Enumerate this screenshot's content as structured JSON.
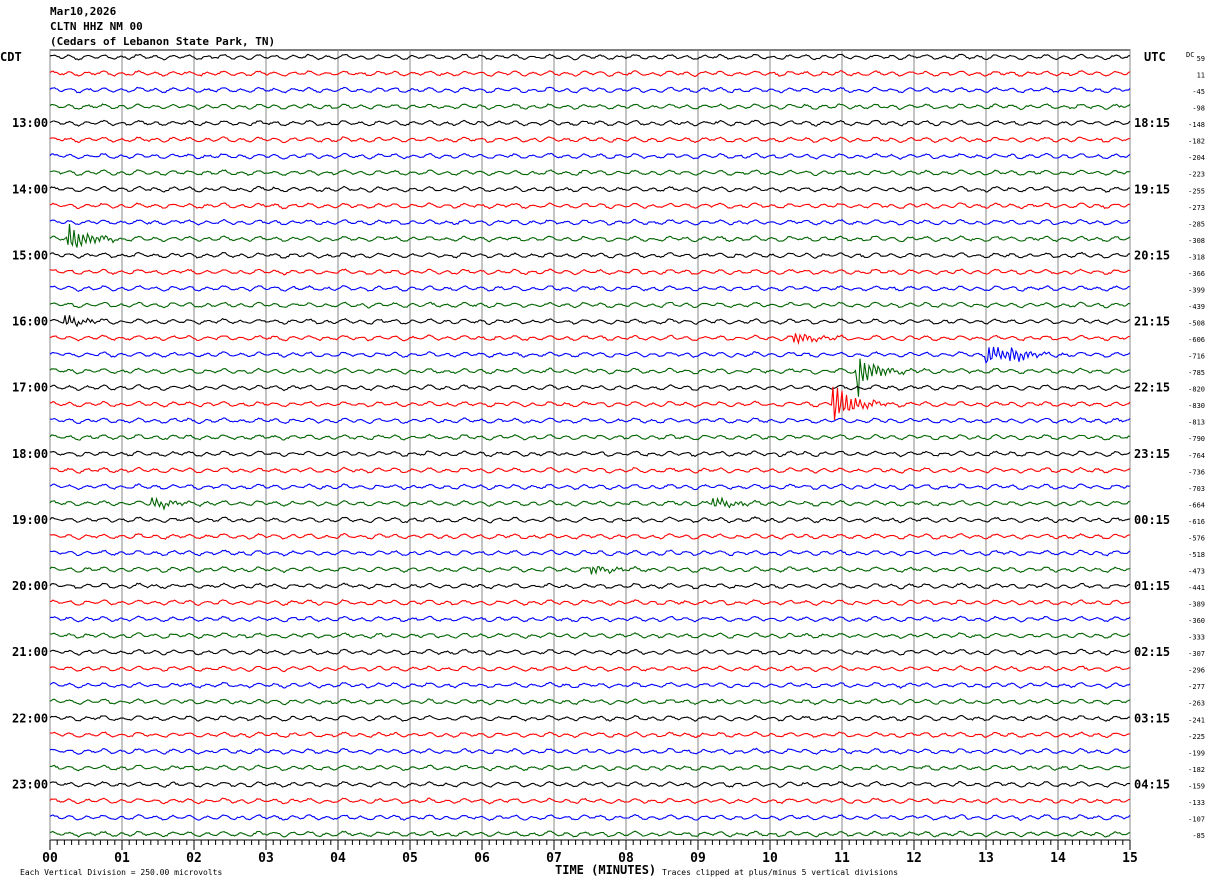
{
  "header": {
    "date": "Mar10,2026",
    "station": "CLTN HHZ NM 00",
    "location": "(Cedars of Lebanon State Park, TN)"
  },
  "chart_data": {
    "type": "line",
    "title": "",
    "left_axis_label": "CDT",
    "right_axis_label": "UTC",
    "dc_label": "DC",
    "xlabel": "TIME (MINUTES)",
    "xlim": [
      0,
      15
    ],
    "x_ticks": [
      "00",
      "01",
      "02",
      "03",
      "04",
      "05",
      "06",
      "07",
      "08",
      "09",
      "10",
      "11",
      "12",
      "13",
      "14",
      "15"
    ],
    "left_hour_labels": [
      "13:00",
      "14:00",
      "15:00",
      "16:00",
      "17:00",
      "18:00",
      "19:00",
      "20:00",
      "21:00",
      "22:00",
      "23:00"
    ],
    "right_hour_labels": [
      "18:15",
      "19:15",
      "20:15",
      "21:15",
      "22:15",
      "23:15",
      "00:15",
      "01:15",
      "02:15",
      "03:15",
      "04:15"
    ],
    "trace_colors": [
      "#000000",
      "#ff0000",
      "#0000ff",
      "#006400"
    ],
    "traces_per_hour": 4,
    "dc_offsets": [
      59,
      11,
      -45,
      -98,
      -148,
      -182,
      -204,
      -223,
      -255,
      -273,
      -285,
      -308,
      -318,
      -366,
      -399,
      -439,
      -508,
      -606,
      -716,
      -785,
      -820,
      -830,
      -813,
      -790,
      -764,
      -736,
      -703,
      -664,
      -616,
      -576,
      -518,
      -473,
      -441,
      -389,
      -360,
      -333,
      -307,
      -296,
      -277,
      -263,
      -241,
      -225,
      -199,
      -182,
      -159,
      -133,
      -107,
      -85
    ],
    "grid": true
  },
  "footer": {
    "scale_note": "Each Vertical Division =  250.00 microvolts",
    "clip_note": "Traces clipped at plus/minus 5 vertical divisions"
  }
}
